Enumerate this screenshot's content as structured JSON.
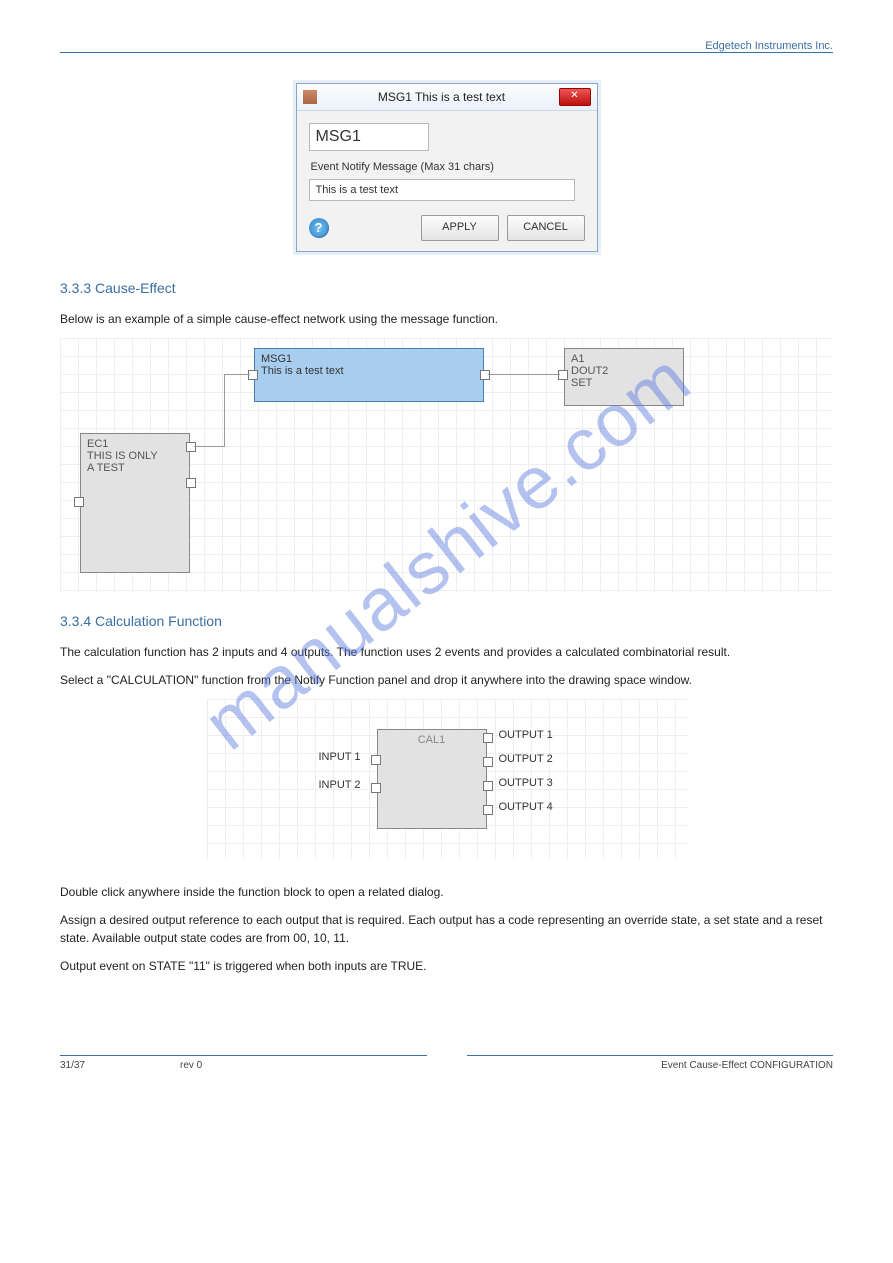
{
  "header_right": "Edgetech Instruments Inc.",
  "dialog": {
    "title": "MSG1 This is a test text",
    "name": "MSG1",
    "field_label": "Event Notify Message (Max 31 chars)",
    "value": "This is a test text",
    "apply": "APPLY",
    "cancel": "CANCEL"
  },
  "text": {
    "h1": "3.3.3 Cause-Effect",
    "p1": "Below is an example of a simple cause-effect network using the message function.",
    "h2": "3.3.4 Calculation Function",
    "p2": "The calculation function has 2 inputs and 4 outputs. The function uses 2 events and provides a calculated combinatorial result.",
    "p3": "Select a \"CALCULATION\" function from the Notify Function panel and drop it anywhere into the drawing space window.",
    "p4": "Double click anywhere inside the function block to open a related dialog.",
    "p5": "Assign a desired output reference to each output that is required. Each output has a code representing an override state, a set state and a reset state. Available output state codes are from 00, 10, 11.",
    "p6": "Output event on STATE \"11\" is triggered when both inputs are TRUE."
  },
  "diagram1": {
    "ec1_l1": "EC1",
    "ec1_l2": "THIS IS ONLY",
    "ec1_l3": "A TEST",
    "msg_l1": "MSG1",
    "msg_l2": "This is a test text",
    "a1_l1": "A1",
    "a1_l2": "DOUT2",
    "a1_l3": "SET"
  },
  "diagram2": {
    "title": "CAL1",
    "in1": "INPUT 1",
    "in2": "INPUT 2",
    "out1": "OUTPUT 1",
    "out2": "OUTPUT 2",
    "out3": "OUTPUT 3",
    "out4": "OUTPUT 4"
  },
  "footer": {
    "pg": "31/37",
    "rev": "rev 0",
    "title": "Event Cause-Effect CONFIGURATION"
  },
  "watermark": "manualshive.com"
}
